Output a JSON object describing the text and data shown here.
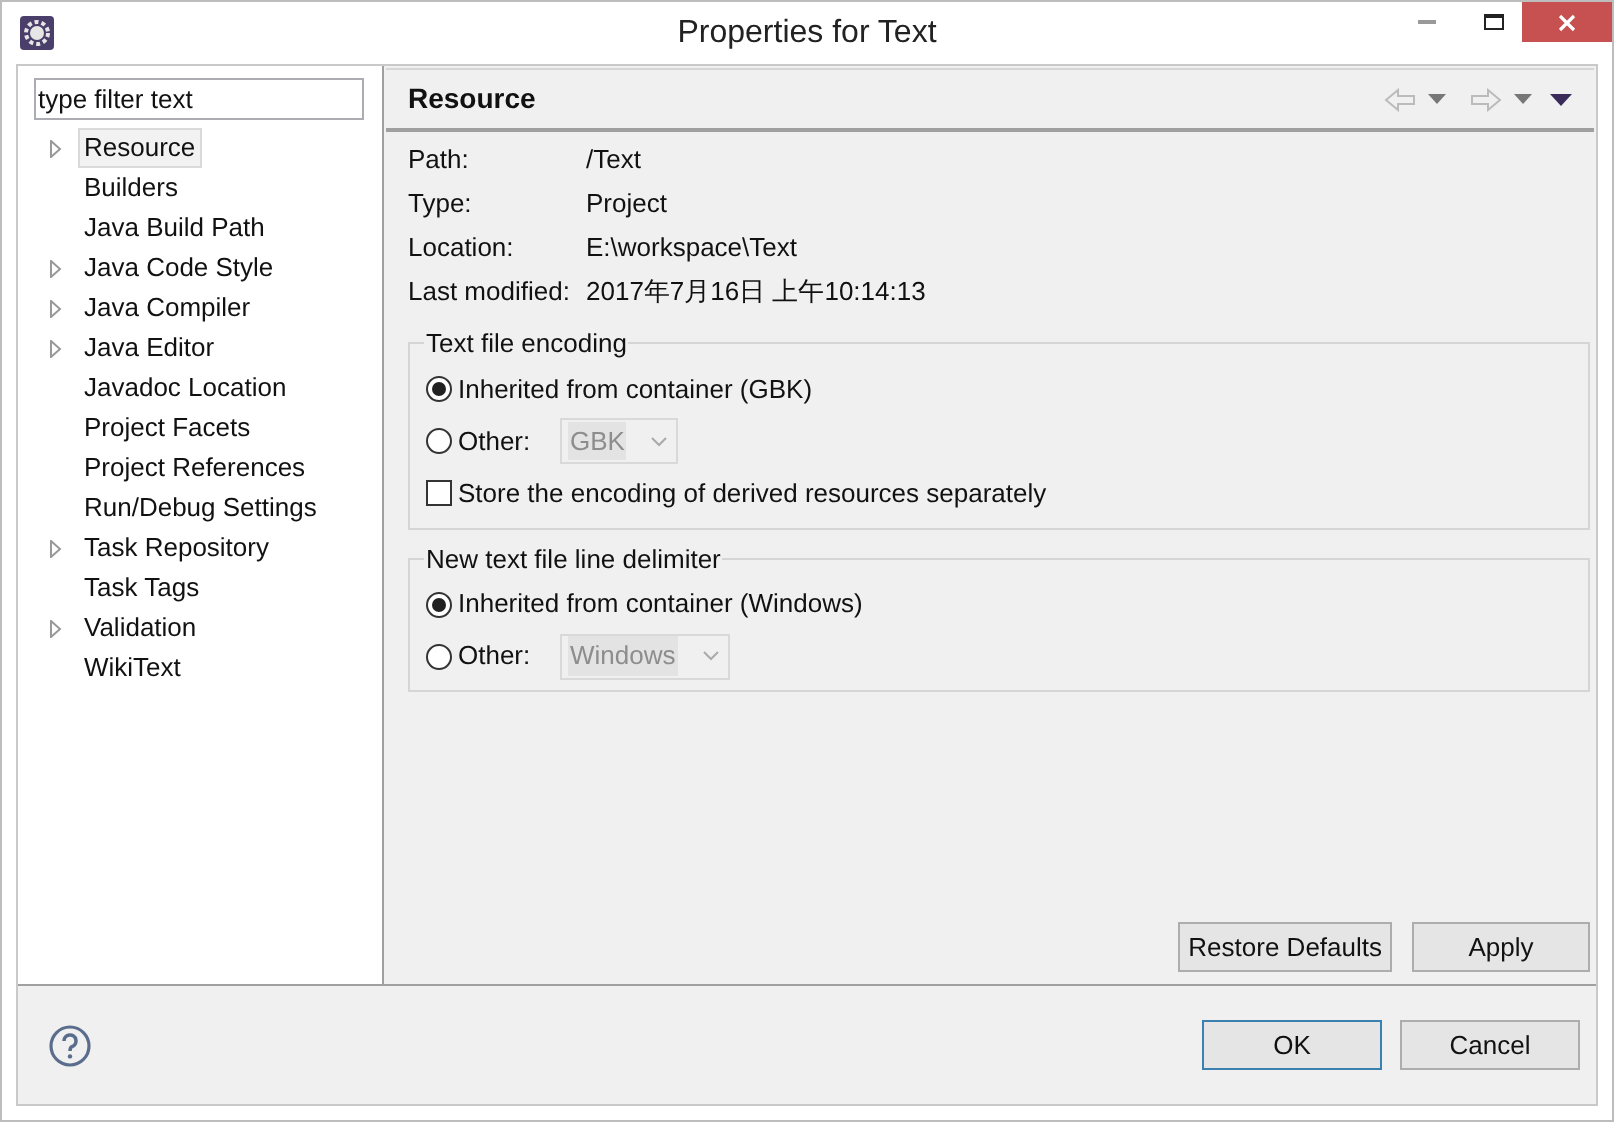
{
  "window": {
    "title": "Properties for Text"
  },
  "filter": {
    "value": "type filter text"
  },
  "tree": [
    {
      "label": "Resource",
      "expandable": true,
      "selected": true
    },
    {
      "label": "Builders",
      "expandable": false,
      "selected": false
    },
    {
      "label": "Java Build Path",
      "expandable": false,
      "selected": false
    },
    {
      "label": "Java Code Style",
      "expandable": true,
      "selected": false
    },
    {
      "label": "Java Compiler",
      "expandable": true,
      "selected": false
    },
    {
      "label": "Java Editor",
      "expandable": true,
      "selected": false
    },
    {
      "label": "Javadoc Location",
      "expandable": false,
      "selected": false
    },
    {
      "label": "Project Facets",
      "expandable": false,
      "selected": false
    },
    {
      "label": "Project References",
      "expandable": false,
      "selected": false
    },
    {
      "label": "Run/Debug Settings",
      "expandable": false,
      "selected": false
    },
    {
      "label": "Task Repository",
      "expandable": true,
      "selected": false
    },
    {
      "label": "Task Tags",
      "expandable": false,
      "selected": false
    },
    {
      "label": "Validation",
      "expandable": true,
      "selected": false
    },
    {
      "label": "WikiText",
      "expandable": false,
      "selected": false
    }
  ],
  "page": {
    "title": "Resource",
    "info": [
      {
        "label": "Path:",
        "value": "/Text"
      },
      {
        "label": "Type:",
        "value": "Project"
      },
      {
        "label": "Location:",
        "value": "E:\\workspace\\Text"
      },
      {
        "label": "Last modified:",
        "value": "2017年7月16日 上午10:14:13"
      }
    ],
    "groups": [
      {
        "title": "Text file encoding",
        "items": [
          {
            "kind": "radio",
            "label": "Inherited from container (GBK)",
            "selected": true
          },
          {
            "kind": "radio-combo",
            "label": "Other:",
            "selected": false,
            "value": "GBK",
            "disabled": true
          },
          {
            "kind": "checkbox",
            "label": "Store the encoding of derived resources separately",
            "checked": false
          }
        ]
      },
      {
        "title": "New text file line delimiter",
        "items": [
          {
            "kind": "radio",
            "label": "Inherited from container (Windows)",
            "selected": true
          },
          {
            "kind": "radio-combo",
            "label": "Other:",
            "selected": false,
            "value": "Windows",
            "disabled": true
          }
        ]
      }
    ],
    "buttons": [
      "Restore Defaults",
      "Apply"
    ]
  },
  "footer_buttons": [
    {
      "label": "OK",
      "default": true
    },
    {
      "label": "Cancel",
      "default": false
    }
  ]
}
